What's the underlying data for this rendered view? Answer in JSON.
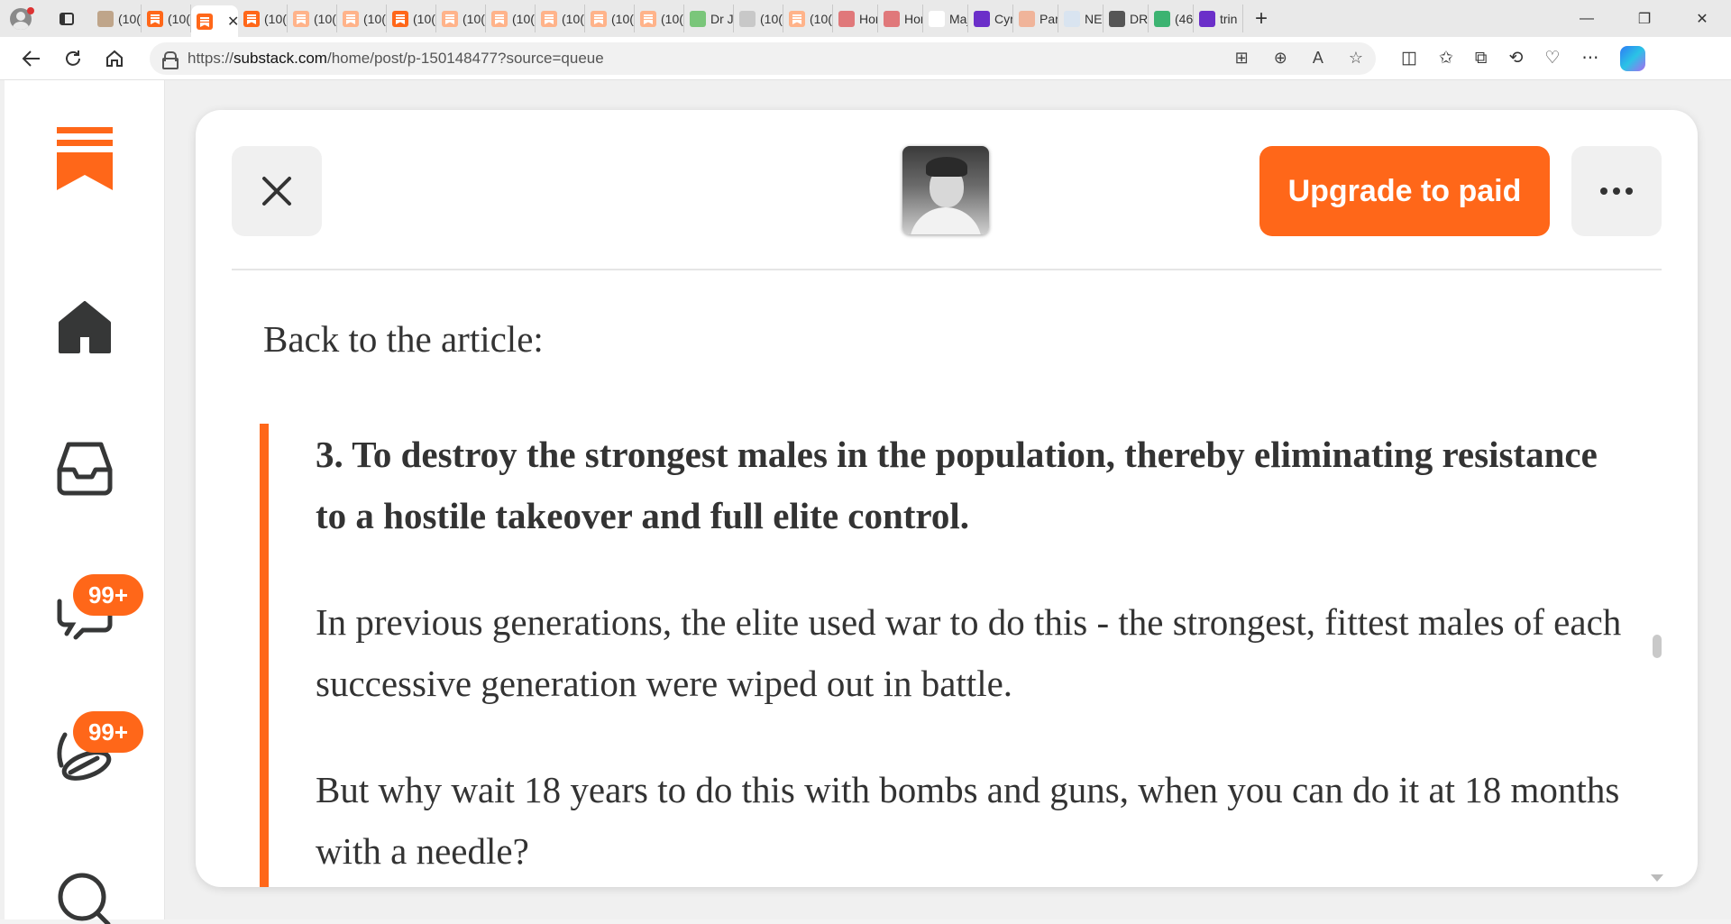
{
  "browser": {
    "tabs": [
      {
        "label": "(10(",
        "favicon_color": "#bfa58a",
        "favicon": "image"
      },
      {
        "label": "(10(",
        "favicon_color": "#ff6719",
        "favicon": "substack"
      },
      {
        "label": "",
        "favicon_color": "#ff6719",
        "favicon": "substack",
        "active": true
      },
      {
        "label": "(10(",
        "favicon_color": "#ff6719",
        "favicon": "substack"
      },
      {
        "label": "(10(",
        "favicon_color": "#ffb38a",
        "favicon": "substack"
      },
      {
        "label": "(10(",
        "favicon_color": "#ffb38a",
        "favicon": "substack"
      },
      {
        "label": "(10(",
        "favicon_color": "#ff6719",
        "favicon": "substack"
      },
      {
        "label": "(10(",
        "favicon_color": "#ffb38a",
        "favicon": "substack"
      },
      {
        "label": "(10(",
        "favicon_color": "#ffb38a",
        "favicon": "substack"
      },
      {
        "label": "(10(",
        "favicon_color": "#ffb38a",
        "favicon": "substack"
      },
      {
        "label": "(10(",
        "favicon_color": "#ffb38a",
        "favicon": "substack"
      },
      {
        "label": "(10(",
        "favicon_color": "#ffb38a",
        "favicon": "substack"
      },
      {
        "label": "Dr J",
        "favicon_color": "#7ac67a",
        "favicon": "play"
      },
      {
        "label": "(10(",
        "favicon_color": "#c8c8c8",
        "favicon": "image"
      },
      {
        "label": "(10(",
        "favicon_color": "#ffb38a",
        "favicon": "substack"
      },
      {
        "label": "Hor",
        "favicon_color": "#e0787a",
        "favicon": "person"
      },
      {
        "label": "Hor",
        "favicon_color": "#e0787a",
        "favicon": "person"
      },
      {
        "label": "Maj",
        "favicon_color": "#ffffff",
        "favicon": "search"
      },
      {
        "label": "Cyr",
        "favicon_color": "#6b2fc9",
        "favicon": "yahoo"
      },
      {
        "label": "Par",
        "favicon_color": "#f0b49a",
        "favicon": "letter-b"
      },
      {
        "label": "NEV",
        "favicon_color": "#d9e4f0",
        "favicon": "gp"
      },
      {
        "label": "DRI",
        "favicon_color": "#555555",
        "favicon": "stripes"
      },
      {
        "label": "(46",
        "favicon_color": "#3cb371",
        "favicon": "g"
      },
      {
        "label": "trin",
        "favicon_color": "#6b2fc9",
        "favicon": "yahoo"
      }
    ],
    "new_tab_symbol": "+",
    "url_prefix": "https://",
    "url_host": "substack.com",
    "url_path": "/home/post/p-150148477?source=queue",
    "window_controls": [
      "—",
      "❐",
      "✕"
    ]
  },
  "sidebar": {
    "items": [
      {
        "name": "logo",
        "icon": "substack-logo-icon"
      },
      {
        "name": "home",
        "icon": "home-icon"
      },
      {
        "name": "inbox",
        "icon": "inbox-icon"
      },
      {
        "name": "chat",
        "icon": "chat-icon",
        "badge": "99+"
      },
      {
        "name": "activity",
        "icon": "activity-icon",
        "badge": "99+"
      },
      {
        "name": "search",
        "icon": "search-icon"
      }
    ]
  },
  "post": {
    "upgrade_label": "Upgrade to paid",
    "back_text": "Back to the article:",
    "quote": [
      {
        "text": "3. To destroy the strongest males in the population, thereby eliminating resistance to a hostile takeover and full elite control.",
        "bold": true
      },
      {
        "text": "In previous generations, the elite used war to do this - the strongest, fittest males of each successive generation were wiped out in battle.",
        "bold": false
      },
      {
        "text": "But why wait 18 years to do this with bombs and guns, when you can do it at 18 months with a needle?",
        "bold": false
      }
    ]
  },
  "colors": {
    "brand": "#ff6719",
    "text": "#333333"
  }
}
